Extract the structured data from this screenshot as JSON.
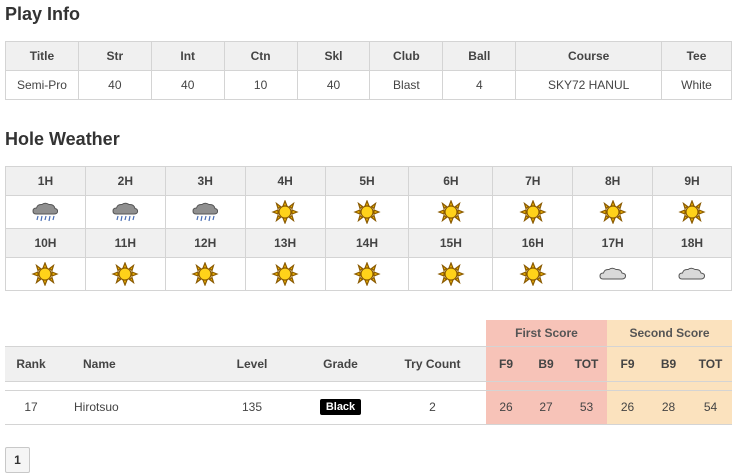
{
  "play_info": {
    "title": "Play Info",
    "headers": [
      "Title",
      "Str",
      "Int",
      "Ctn",
      "Skl",
      "Club",
      "Ball",
      "Course",
      "Tee"
    ],
    "values": [
      "Semi-Pro",
      "40",
      "40",
      "10",
      "40",
      "Blast",
      "4",
      "SKY72 HANUL",
      "White"
    ]
  },
  "hole_weather": {
    "title": "Hole Weather",
    "row1": [
      {
        "label": "1H",
        "icon": "rain-cloud-icon"
      },
      {
        "label": "2H",
        "icon": "rain-cloud-icon"
      },
      {
        "label": "3H",
        "icon": "rain-cloud-icon"
      },
      {
        "label": "4H",
        "icon": "sun-icon"
      },
      {
        "label": "5H",
        "icon": "sun-icon"
      },
      {
        "label": "6H",
        "icon": "sun-icon"
      },
      {
        "label": "7H",
        "icon": "sun-icon"
      },
      {
        "label": "8H",
        "icon": "sun-icon"
      },
      {
        "label": "9H",
        "icon": "sun-icon"
      }
    ],
    "row2": [
      {
        "label": "10H",
        "icon": "sun-icon"
      },
      {
        "label": "11H",
        "icon": "sun-icon"
      },
      {
        "label": "12H",
        "icon": "sun-icon"
      },
      {
        "label": "13H",
        "icon": "sun-icon"
      },
      {
        "label": "14H",
        "icon": "sun-icon"
      },
      {
        "label": "15H",
        "icon": "sun-icon"
      },
      {
        "label": "16H",
        "icon": "sun-icon"
      },
      {
        "label": "17H",
        "icon": "cloud-icon"
      },
      {
        "label": "18H",
        "icon": "cloud-icon"
      }
    ]
  },
  "ranking": {
    "group_first": "First Score",
    "group_second": "Second Score",
    "headers": {
      "rank": "Rank",
      "name": "Name",
      "level": "Level",
      "grade": "Grade",
      "try_count": "Try Count",
      "f9": "F9",
      "b9": "B9",
      "tot": "TOT"
    },
    "row": {
      "rank": "17",
      "name": "Hirotsuo",
      "level": "135",
      "grade": "Black",
      "try_count": "2",
      "first_f9": "26",
      "first_b9": "27",
      "first_tot": "53",
      "second_f9": "26",
      "second_b9": "28",
      "second_tot": "54"
    }
  },
  "pagination": {
    "current": "1"
  },
  "colors": {
    "first_score_bg": "#f7c3b8",
    "second_score_bg": "#fbe2be",
    "rank_green": "#3a8a2e",
    "grade_black": "#000000"
  }
}
